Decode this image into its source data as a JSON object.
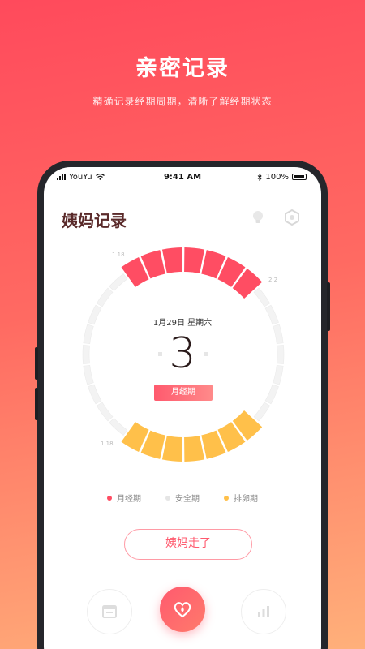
{
  "promo": {
    "headline": "亲密记录",
    "subline": "精确记录经期周期，清晰了解经期状态"
  },
  "status_bar": {
    "carrier": "YouYu",
    "time": "9:41 AM",
    "battery": "100%"
  },
  "app": {
    "title": "姨妈记录"
  },
  "cycle": {
    "date": "1月29日 星期六",
    "day": "3",
    "phase": "月经期",
    "labels": {
      "period_start": "1.18",
      "period_end": "2.2",
      "ovulation": "1.18"
    }
  },
  "legend": {
    "period": "月经期",
    "safe": "安全期",
    "ovulation": "排卵期"
  },
  "actions": {
    "leave_button": "姨妈走了"
  },
  "colors": {
    "period": "#ff4d63",
    "ovulation": "#ffc04a",
    "safe": "#f3f3f3"
  },
  "icons": {
    "bulb": "lightbulb-icon",
    "settings": "hexagon-settings-icon",
    "calendar": "calendar-icon",
    "heart": "heart-drop-icon",
    "stats": "bar-chart-icon"
  }
}
